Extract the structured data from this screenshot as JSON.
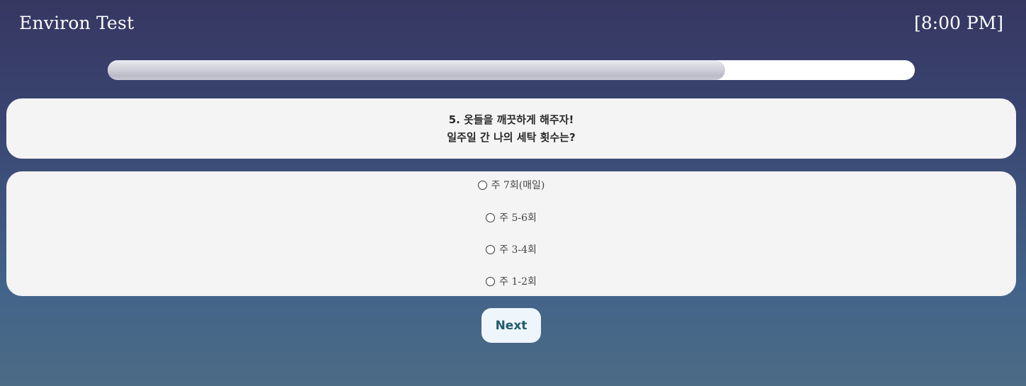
{
  "header": {
    "title": "Environ Test",
    "time": "[8:00 PM]"
  },
  "progress": {
    "fraction": 0.765
  },
  "question": {
    "line1": "5. 옷들을 깨끗하게 해주자!",
    "line2": "일주일 간 나의 세탁 횟수는?"
  },
  "options": [
    {
      "label": "주 7회(매일)"
    },
    {
      "label": "주 5-6회"
    },
    {
      "label": "주 3-4회"
    },
    {
      "label": "주 1-2회"
    }
  ],
  "actions": {
    "next_label": "Next"
  },
  "colors": {
    "background_top": "#363761",
    "background_bottom": "#4c6b85",
    "card": "#f4f4f4",
    "button_text": "#1f5b6e"
  }
}
